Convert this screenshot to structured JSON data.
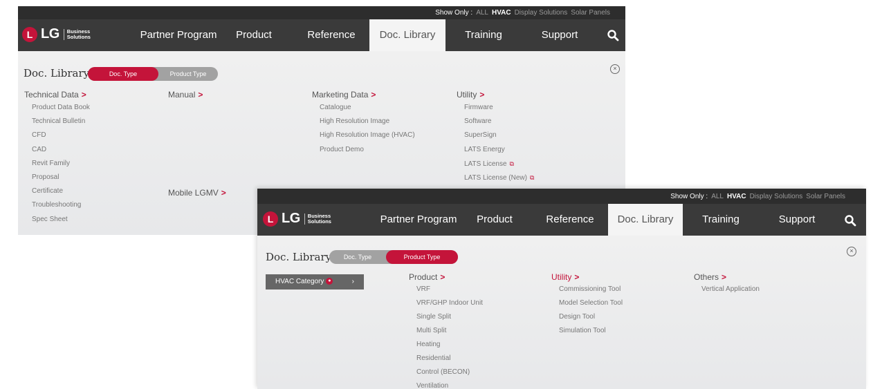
{
  "brand": {
    "logo_letter": "L",
    "logo_text": "LG",
    "logo_sub_1": "Business",
    "logo_sub_2": "Solutions",
    "accent_color": "#c4143a"
  },
  "show_only": {
    "label": "Show Only :",
    "options": [
      "ALL",
      "HVAC",
      "Display Solutions",
      "Solar Panels"
    ],
    "selected": "HVAC"
  },
  "nav": {
    "items": [
      "Partner Program",
      "Product",
      "Reference",
      "Doc. Library",
      "Training",
      "Support"
    ],
    "active": "Doc. Library",
    "search_icon": "search-icon"
  },
  "panel1": {
    "title": "Doc. Library",
    "toggle": {
      "doc_type": "Doc. Type",
      "product_type": "Product Type",
      "selected": "Doc. Type"
    },
    "close_glyph": "×",
    "columns": [
      {
        "heading": "Technical Data",
        "items": [
          "Product Data Book",
          "Technical Bulletin",
          "CFD",
          "CAD",
          "Revit Family",
          "Proposal",
          "Certificate",
          "Troubleshooting",
          "Spec Sheet"
        ]
      },
      {
        "heading": "Manual",
        "items": []
      },
      {
        "heading": "Marketing Data",
        "items": [
          "Catalogue",
          "High Resolution Image",
          "High Resolution Image (HVAC)",
          "Product Demo"
        ]
      },
      {
        "heading": "Utility",
        "items": [
          "Firmware",
          "Software",
          "SuperSign",
          "LATS Energy",
          "LATS License",
          "LATS License (New)"
        ]
      }
    ],
    "extra_heading": "Mobile LGMV",
    "external_link_glyph": "⧉"
  },
  "panel2": {
    "title": "Doc. Library",
    "toggle": {
      "doc_type": "Doc. Type",
      "product_type": "Product Type",
      "selected": "Product Type"
    },
    "close_glyph": "×",
    "category_button": {
      "label": "HVAC Category",
      "badge": "●",
      "chevron": "›"
    },
    "columns": [
      {
        "heading": "Product",
        "highlight": false,
        "items": [
          "VRF",
          "VRF/GHP Indoor Unit",
          "Single Split",
          "Multi Split",
          "Heating",
          "Residential",
          "Control (BECON)",
          "Ventilation"
        ]
      },
      {
        "heading": "Utility",
        "highlight": true,
        "items": [
          "Commissioning Tool",
          "Model Selection Tool",
          "Design Tool",
          "Simulation Tool"
        ]
      },
      {
        "heading": "Others",
        "highlight": false,
        "items": [
          "Vertical Application"
        ]
      }
    ]
  },
  "arrow_glyph": ">"
}
